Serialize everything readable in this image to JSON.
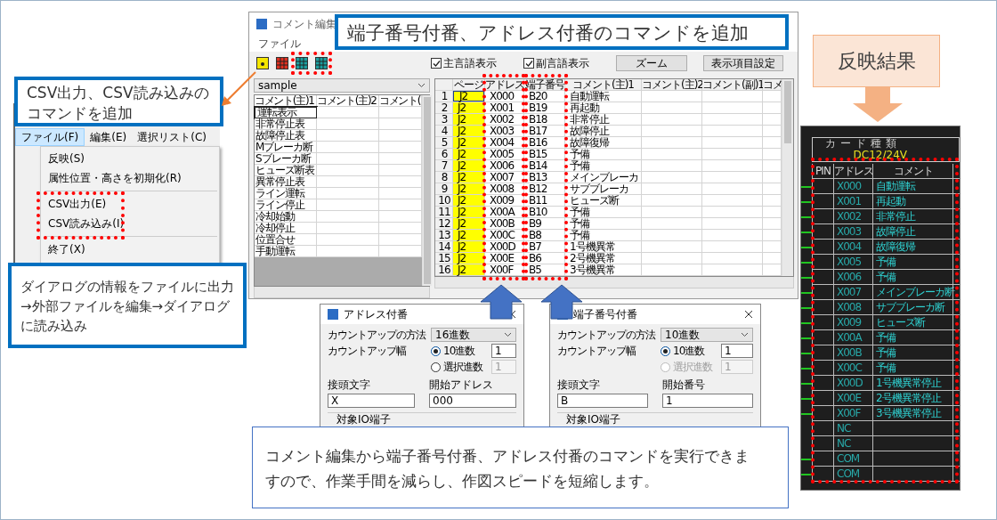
{
  "main_window": {
    "title": "コメント編集",
    "menu": [
      {
        "label": "ファイル"
      }
    ],
    "checkboxes": [
      {
        "label": "主言語表示",
        "checked": true
      },
      {
        "label": "副言語表示",
        "checked": true
      }
    ],
    "buttons": [
      "ズーム",
      "表示項目設定"
    ],
    "list_panel": {
      "dropdown": "sample",
      "columns": [
        "コメント(主)1",
        "コメント(主)2",
        "コメント("
      ],
      "rows": [
        {
          "text": "運転表示",
          "selected": true
        },
        {
          "text": "非常停止表",
          "selected": false
        },
        {
          "text": "故障停止表",
          "selected": false
        },
        {
          "text": "Mブレーカ断",
          "selected": false
        },
        {
          "text": "Sブレーカ断",
          "selected": false
        },
        {
          "text": "ヒューズ断表",
          "selected": false
        },
        {
          "text": "異常停止表",
          "selected": false
        },
        {
          "text": "ライン運転",
          "selected": false
        },
        {
          "text": "ライン停止",
          "selected": false
        },
        {
          "text": "冷却始動",
          "selected": false
        },
        {
          "text": "冷却停止",
          "selected": false
        },
        {
          "text": "位置合せ",
          "selected": false
        },
        {
          "text": "手動運転",
          "selected": false
        }
      ]
    },
    "grid": {
      "columns": [
        "ページ",
        "アドレス",
        "端子番号",
        "コメント(主)1",
        "コメント(主)2",
        "コメント(副)1",
        "コメ"
      ],
      "rows": [
        {
          "number": "1",
          "page": "J2",
          "address": "X000",
          "terminal": "B20",
          "comment": "自動運転",
          "selected": true
        },
        {
          "number": "2",
          "page": "J2",
          "address": "X001",
          "terminal": "B19",
          "comment": "再起動",
          "selected": false
        },
        {
          "number": "3",
          "page": "J2",
          "address": "X002",
          "terminal": "B18",
          "comment": "非常停止",
          "selected": false
        },
        {
          "number": "4",
          "page": "J2",
          "address": "X003",
          "terminal": "B17",
          "comment": "故障停止",
          "selected": false
        },
        {
          "number": "5",
          "page": "J2",
          "address": "X004",
          "terminal": "B16",
          "comment": "故障復帰",
          "selected": false
        },
        {
          "number": "6",
          "page": "J2",
          "address": "X005",
          "terminal": "B15",
          "comment": "予備",
          "selected": false
        },
        {
          "number": "7",
          "page": "J2",
          "address": "X006",
          "terminal": "B14",
          "comment": "予備",
          "selected": false
        },
        {
          "number": "8",
          "page": "J2",
          "address": "X007",
          "terminal": "B13",
          "comment": "メインブレーカ",
          "selected": false
        },
        {
          "number": "9",
          "page": "J2",
          "address": "X008",
          "terminal": "B12",
          "comment": "サブブレーカ",
          "selected": false
        },
        {
          "number": "10",
          "page": "J2",
          "address": "X009",
          "terminal": "B11",
          "comment": "ヒューズ断",
          "selected": false
        },
        {
          "number": "11",
          "page": "J2",
          "address": "X00A",
          "terminal": "B10",
          "comment": "予備",
          "selected": false
        },
        {
          "number": "12",
          "page": "J2",
          "address": "X00B",
          "terminal": "B9",
          "comment": "予備",
          "selected": false
        },
        {
          "number": "13",
          "page": "J2",
          "address": "X00C",
          "terminal": "B8",
          "comment": "予備",
          "selected": false
        },
        {
          "number": "14",
          "page": "J2",
          "address": "X00D",
          "terminal": "B7",
          "comment": "1号機異常",
          "selected": false
        },
        {
          "number": "15",
          "page": "J2",
          "address": "X00E",
          "terminal": "B6",
          "comment": "2号機異常",
          "selected": false
        },
        {
          "number": "16",
          "page": "J2",
          "address": "X00F",
          "terminal": "B5",
          "comment": "3号機異常",
          "selected": false
        }
      ]
    }
  },
  "file_menu": {
    "menu": [
      {
        "label": "ファイル(F)",
        "selected": true
      },
      {
        "label": "編集(E)",
        "selected": false
      },
      {
        "label": "選択リスト(C)",
        "selected": false
      }
    ],
    "items": [
      {
        "kind": "item",
        "label": "反映(S)"
      },
      {
        "kind": "item",
        "label": "属性位置・高さを初期化(R)"
      },
      {
        "kind": "separator"
      },
      {
        "kind": "item",
        "label": "CSV出力(E)"
      },
      {
        "kind": "item",
        "label": "CSV読み込み(I)"
      },
      {
        "kind": "separator"
      },
      {
        "kind": "item",
        "label": "終了(X)"
      }
    ]
  },
  "callouts": [
    {
      "text": "CSV出力、CSV読み込みのコマンドを追加"
    },
    {
      "text": "ダイアログの情報をファイルに出力→外部ファイルを編集→ダイアログに読み込み"
    },
    {
      "text": "端子番号付番、アドレス付番のコマンドを追加"
    },
    {
      "text": "コメント編集から端子番号付番、アドレス付番のコマンドを実行できますので、作業手間を減らし、作図スピードを短縮します。"
    }
  ],
  "dialogs": [
    {
      "title": "アドレス付番",
      "method_label": "カウントアップの方法",
      "method": "16進数",
      "step_label": "カウントアップ幅",
      "options": [
        {
          "label": "10進数",
          "selected": true,
          "disabled": false,
          "value": "1"
        },
        {
          "label": "選択進数",
          "selected": false,
          "disabled": false,
          "value": "1"
        }
      ],
      "prefix_label": "接頭文字",
      "prefix": "X",
      "start_label": "開始アドレス",
      "start": "000",
      "group_label": "対象IO端子"
    },
    {
      "title": "端子番号付番",
      "method_label": "カウントアップの方法",
      "method": "10進数",
      "step_label": "カウントアップ幅",
      "options": [
        {
          "label": "10進数",
          "selected": true,
          "disabled": false,
          "value": "1"
        },
        {
          "label": "選択進数",
          "selected": false,
          "disabled": true,
          "value": "1"
        }
      ],
      "prefix_label": "接頭文字",
      "prefix": "B",
      "start_label": "開始番号",
      "start": "1",
      "group_label": "対象IO端子"
    }
  ],
  "result": {
    "label": "反映結果",
    "cad": {
      "card_label": "カード種類",
      "voltage": "DC12/24V",
      "columns": [
        "PIN",
        "アドレス",
        "コメント"
      ],
      "rows": [
        {
          "address": "X000",
          "comment": "自動運転",
          "wired": true
        },
        {
          "address": "X001",
          "comment": "再起動",
          "wired": true
        },
        {
          "address": "X002",
          "comment": "非常停止",
          "wired": true
        },
        {
          "address": "X003",
          "comment": "故障停止",
          "wired": true
        },
        {
          "address": "X004",
          "comment": "故障復帰",
          "wired": true
        },
        {
          "address": "X005",
          "comment": "予備",
          "wired": true
        },
        {
          "address": "X006",
          "comment": "予備",
          "wired": true
        },
        {
          "address": "X007",
          "comment": "メインブレーカ断",
          "wired": true
        },
        {
          "address": "X008",
          "comment": "サブブレーカ断",
          "wired": true
        },
        {
          "address": "X009",
          "comment": "ヒューズ断",
          "wired": true
        },
        {
          "address": "X00A",
          "comment": "予備",
          "wired": true
        },
        {
          "address": "X00B",
          "comment": "予備",
          "wired": true
        },
        {
          "address": "X00C",
          "comment": "予備",
          "wired": true
        },
        {
          "address": "X00D",
          "comment": "1号機異常停止",
          "wired": true
        },
        {
          "address": "X00E",
          "comment": "2号機異常停止",
          "wired": true
        },
        {
          "address": "X00F",
          "comment": "3号機異常停止",
          "wired": true
        },
        {
          "address": "NC",
          "wired": false
        },
        {
          "address": "NC",
          "wired": false
        },
        {
          "address": "COM",
          "wired": true
        },
        {
          "address": "COM",
          "wired": true
        }
      ]
    }
  }
}
